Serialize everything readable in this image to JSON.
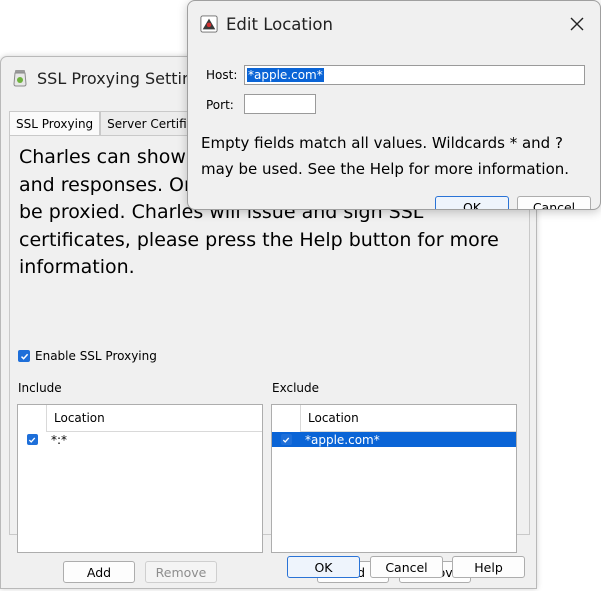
{
  "ssl_dialog": {
    "title": "SSL Proxying Settings",
    "tabs": [
      {
        "label": "SSL Proxying",
        "active": true
      },
      {
        "label": "Server Certificates",
        "active": false
      }
    ],
    "description": "Charles can show you the contents of SSL requests and responses. Only the locations listed below will be proxied. Charles will issue and sign SSL certificates, please press the Help button for more information.",
    "enable_ssl_proxying": {
      "label": "Enable SSL Proxying",
      "checked": true
    },
    "include": {
      "label": "Include",
      "column_header": "Location",
      "rows": [
        {
          "checked": true,
          "location": "*:*",
          "selected": false
        }
      ],
      "add_label": "Add",
      "remove_label": "Remove",
      "remove_enabled": false
    },
    "exclude": {
      "label": "Exclude",
      "column_header": "Location",
      "rows": [
        {
          "checked": true,
          "location": "*apple.com*",
          "selected": true
        }
      ],
      "add_label": "Add",
      "remove_label": "Remove",
      "remove_enabled": true
    },
    "ok_label": "OK",
    "cancel_label": "Cancel",
    "help_label": "Help"
  },
  "edit_dialog": {
    "title": "Edit Location",
    "host_label": "Host:",
    "host_value": "*apple.com*",
    "port_label": "Port:",
    "port_value": "",
    "help_text": "Empty fields match all values. Wildcards * and ? may be used. See the Help for more information.",
    "ok_label": "OK",
    "cancel_label": "Cancel"
  },
  "colors": {
    "accent": "#0a64d6",
    "checkbox": "#1e6fd9",
    "window_bg": "#f0f0f0"
  },
  "icons": {
    "ssl_title_icon": "charles-jar-icon",
    "edit_title_icon": "charles-app-icon",
    "close": "close-icon"
  }
}
